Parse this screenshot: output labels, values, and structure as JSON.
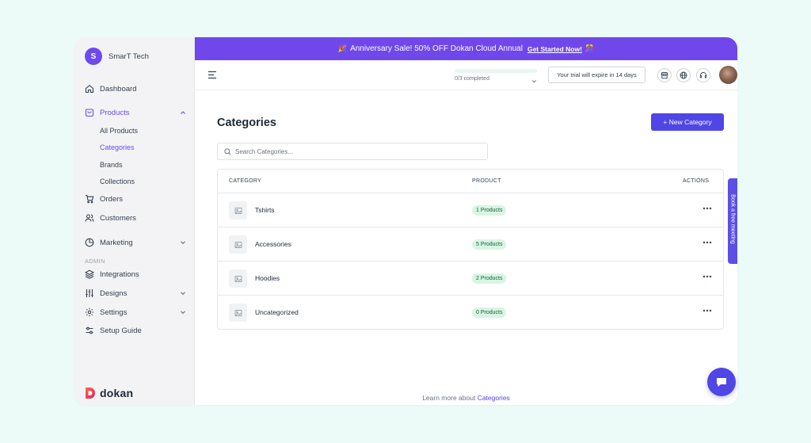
{
  "store": {
    "initial": "S",
    "name": "SmarT Tech"
  },
  "sidebar": {
    "dashboard": "Dashboard",
    "products": "Products",
    "products_sub": [
      "All Products",
      "Categories",
      "Brands",
      "Collections"
    ],
    "orders": "Orders",
    "customers": "Customers",
    "marketing": "Marketing",
    "admin_label": "ADMIN",
    "integrations": "Integrations",
    "designs": "Designs",
    "settings": "Settings",
    "setup_guide": "Setup Guide",
    "logo_text": "dokan"
  },
  "banner": {
    "text": "Anniversary Sale! 50% OFF Dokan Cloud Annual",
    "cta": "Get Started Now!",
    "lead_emoji": "🎉",
    "trail_emoji": "🎊"
  },
  "topbar": {
    "progress_text": "0/3 completed",
    "progress_fraction": 0,
    "trial_text": "Your trial will expire in 14 days"
  },
  "page": {
    "title": "Categories",
    "new_button": "+ New Category",
    "search_placeholder": "Search Categories..."
  },
  "table": {
    "headers": {
      "category": "CATEGORY",
      "product": "PRODUCT",
      "actions": "ACTIONS"
    },
    "rows": [
      {
        "name": "Tshirts",
        "products": "1 Products"
      },
      {
        "name": "Accessories",
        "products": "5 Products"
      },
      {
        "name": "Hoodies",
        "products": "2 Products"
      },
      {
        "name": "Uncategorized",
        "products": "0 Products"
      }
    ]
  },
  "footer": {
    "learn_text": "Learn more about",
    "learn_link": "Categories"
  },
  "side_tab": {
    "text": "Book a free meeting"
  },
  "colors": {
    "accent": "#6d4aed",
    "primary_button": "#4f46e5",
    "badge_bg": "#d8f5e3",
    "badge_text": "#15603a"
  }
}
